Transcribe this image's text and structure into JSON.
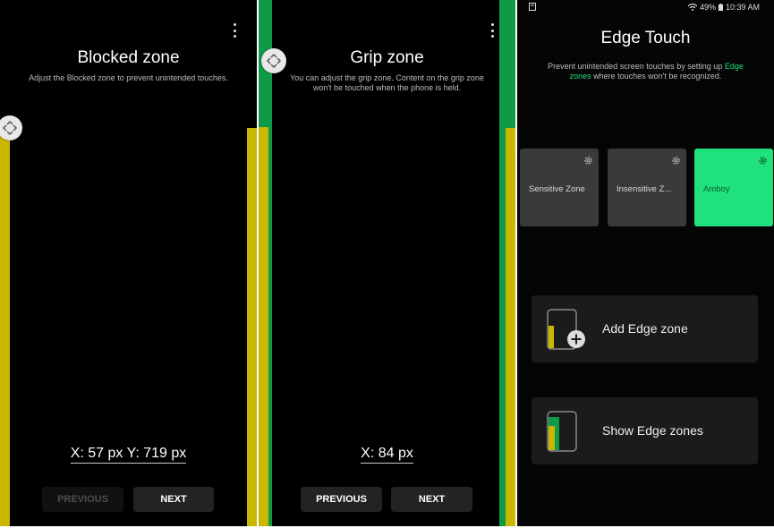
{
  "colors": {
    "yellow": "#c9b700",
    "green": "#0e9a46",
    "accent_green": "#1fe27d",
    "button_bg": "#232323"
  },
  "blocked_zone": {
    "title": "Blocked zone",
    "description": "Adjust the Blocked zone to prevent unintended touches.",
    "coords": "X: 57 px Y: 719 px",
    "previous_label": "PREVIOUS",
    "next_label": "NEXT",
    "menu_icon": "more-vert-icon",
    "handle_icon": "move-handle-icon"
  },
  "grip_zone": {
    "title": "Grip zone",
    "description_line1": "You can adjust the grip zone. Content on the grip zone",
    "description_line2": "won't be touched when the phone is held.",
    "coords": "X: 84 px",
    "previous_label": "PREVIOUS",
    "next_label": "NEXT",
    "menu_icon": "more-vert-icon",
    "handle_icon": "move-handle-icon"
  },
  "edge_touch": {
    "status_bar": {
      "battery": "49%",
      "time": "10:39 AM"
    },
    "title": "Edge Touch",
    "description_part1": "Prevent unintended screen touches by setting up",
    "description_link1": "Edge",
    "description_link2": "zones",
    "description_part2": "where touches won't be recognized.",
    "zones": [
      {
        "name": "Sensitive Zone",
        "icon": "gear-icon",
        "active": false
      },
      {
        "name": "Insensitive Z...",
        "icon": "gear-icon",
        "active": false
      },
      {
        "name": "Amboy",
        "icon": "gear-icon",
        "active": true
      }
    ],
    "actions": [
      {
        "label": "Add Edge zone",
        "icon": "add-edge-zone-icon"
      },
      {
        "label": "Show Edge zones",
        "icon": "show-edge-zones-icon"
      }
    ]
  }
}
